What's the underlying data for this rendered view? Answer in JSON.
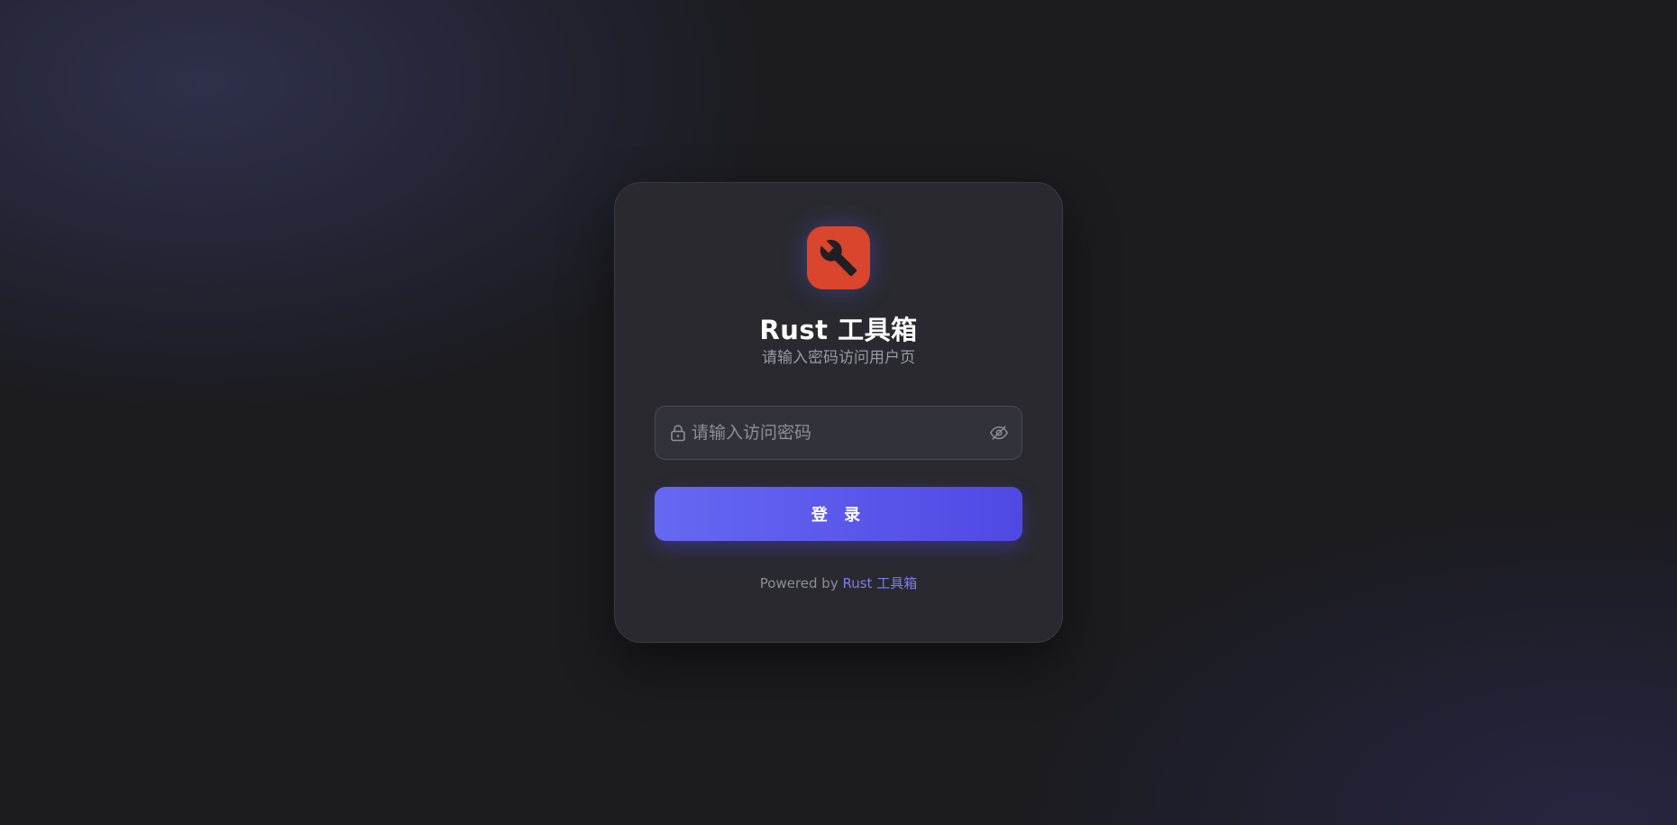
{
  "app": {
    "title": "Rust 工具箱",
    "subtitle": "请输入密码访问用户页",
    "logo_icon": "wrench-icon",
    "logo_color": "#d9452d"
  },
  "form": {
    "password_placeholder": "请输入访问密码",
    "password_value": "",
    "lock_icon": "lock-icon",
    "toggle_icon": "eye-off-icon",
    "login_label": "登 录",
    "button_gradient": [
      "#6668f2",
      "#5048e4"
    ]
  },
  "footer": {
    "prefix": "Powered by ",
    "link_text": "Rust 工具箱",
    "link_color": "#7b7ef0"
  }
}
